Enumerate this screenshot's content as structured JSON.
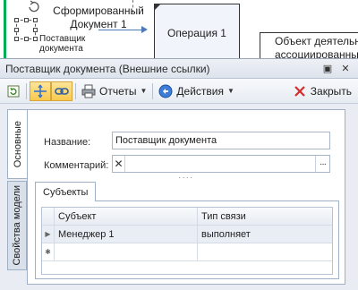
{
  "diagram": {
    "document_title_line1": "Сформированный",
    "document_title_line2": "Документ 1",
    "supplier_label_line1": "Поставщик",
    "supplier_label_line2": "документа",
    "operation_label": "Операция 1",
    "object_label_line1": "Объект деятельно",
    "object_label_line2": "ассоциированный"
  },
  "window": {
    "title": "Поставщик документа (Внешние ссылки)",
    "pin_glyph": "▣",
    "close_glyph": "✕"
  },
  "toolbar": {
    "reports_label": "Отчеты",
    "actions_label": "Действия",
    "close_label": "Закрыть"
  },
  "side_tabs": {
    "main": "Основные",
    "model_props": "Свойства модели"
  },
  "form": {
    "name_label": "Название:",
    "name_value": "Поставщик документа",
    "comment_label": "Комментарий:",
    "comment_value": "",
    "clear_glyph": "✕",
    "more_glyph": "···",
    "grip_glyph": "····"
  },
  "subjects": {
    "tab_label": "Субъекты",
    "columns": [
      "Субъект",
      "Тип связи"
    ],
    "rows": [
      {
        "subject": "Менеджер 1",
        "link_type": "выполняет"
      }
    ],
    "current_row_glyph": "▶",
    "new_row_glyph": "✱"
  },
  "colors": {
    "accent": "#4e79b8",
    "pressed": "#f8c94c",
    "close_red": "#d42b2b",
    "green_line": "#00b050"
  }
}
